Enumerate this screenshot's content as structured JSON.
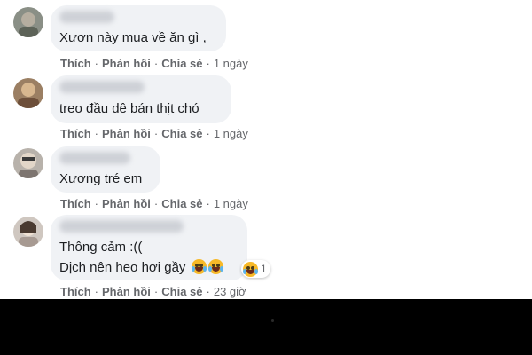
{
  "comments": [
    {
      "text": [
        "Xươn này mua về ăn gì ,"
      ],
      "actions": {
        "like": "Thích",
        "reply": "Phản hồi",
        "share": "Chia sẻ",
        "sep": "·",
        "time": "1 ngày"
      }
    },
    {
      "text": [
        "treo đầu dê bán thịt chó"
      ],
      "actions": {
        "like": "Thích",
        "reply": "Phản hồi",
        "share": "Chia sẻ",
        "sep": "·",
        "time": "1 ngày"
      }
    },
    {
      "text": [
        "Xương tré em"
      ],
      "actions": {
        "like": "Thích",
        "reply": "Phản hồi",
        "share": "Chia sẻ",
        "sep": "·",
        "time": "1 ngày"
      }
    },
    {
      "text": [
        "Thông cảm :((",
        "Dịch nên heo hơi gầy"
      ],
      "actions": {
        "like": "Thích",
        "reply": "Phản hồi",
        "share": "Chia sẻ",
        "sep": "·",
        "time": "23 giờ"
      },
      "reaction_count": "1"
    }
  ],
  "icons": {
    "reaction": "laughing-crying-emoji-icon"
  },
  "colors": {
    "bubble": "#f0f2f5",
    "action_text": "#65676b",
    "text": "#1c1e21"
  }
}
